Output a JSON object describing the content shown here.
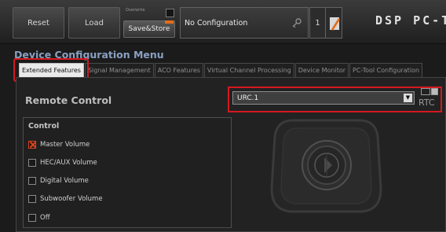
{
  "toolbar": {
    "reset_label": "Reset",
    "load_label": "Load",
    "overwrite_label": "Overwrite",
    "save_store_label": "Save&Store",
    "configuration_value": "No Configuration",
    "config_number": "1",
    "brand": "DSP PC-T"
  },
  "menu": {
    "title": "Device Configuration Menu",
    "tabs": [
      {
        "label": "Extended Features",
        "active": true
      },
      {
        "label": "Signal Management",
        "active": false
      },
      {
        "label": "ACO Features",
        "active": false
      },
      {
        "label": "Virtual Channel Processing",
        "active": false
      },
      {
        "label": "Device Monitor",
        "active": false
      },
      {
        "label": "PC-Tool Configuration",
        "active": false
      }
    ]
  },
  "remote_control": {
    "title": "Remote Control",
    "selected": "URC.1",
    "rtc_label": "RTC",
    "control_group": {
      "title": "Control",
      "options": [
        {
          "label": "Master Volume",
          "checked": true
        },
        {
          "label": "HEC/AUX Volume",
          "checked": false
        },
        {
          "label": "Digital Volume",
          "checked": false
        },
        {
          "label": "Subwoofer Volume",
          "checked": false
        },
        {
          "label": "Off",
          "checked": false
        }
      ]
    }
  },
  "colors": {
    "highlight": "#d6181f",
    "accent_orange": "#e46d1b",
    "title_blue": "#8aa0c2"
  }
}
